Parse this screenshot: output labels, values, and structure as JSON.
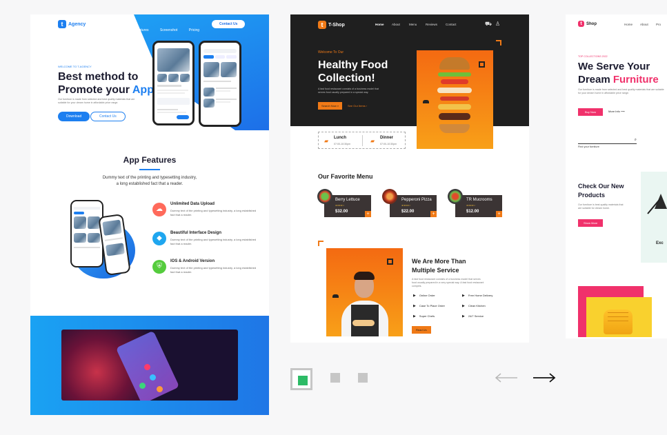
{
  "agency": {
    "brand": "Agency",
    "logo_letter": "t",
    "nav": [
      "Home",
      "Features",
      "Screenshot",
      "Pricing"
    ],
    "contact_button": "Contact Us",
    "eyebrow": "WELCOME TO T-AGENCY",
    "headline_line1": "Best method to",
    "headline_line2_a": "Promote your ",
    "headline_line2_b": "App",
    "description": "Our furniture is made from selected and best quality materials that are suitable for your dream home in affordable price range.",
    "download_button": "Download",
    "contact_button2": "Contact Us",
    "features_title": "App Features",
    "features_subtitle_1": "Dummy text of the printing and typesetting industry,",
    "features_subtitle_2": "a long established fact that a reader.",
    "features": [
      {
        "title": "Unlimited Data Upload",
        "desc": "Dummy text of the printing and typesetting industry, a long established fact that a reader.",
        "color": "#ff6a5b"
      },
      {
        "title": "Beautiful Interface Design",
        "desc": "Dummy text of the printing and typesetting industry, a long established fact that a reader.",
        "color": "#1fa6ef"
      },
      {
        "title": "IOS & Android Version",
        "desc": "Dummy text of the printing and typesetting industry, a long established fact that a reader.",
        "color": "#55cc3d"
      }
    ],
    "colors": {
      "accent": "#1d7ff0",
      "gradient_end": "#1d6fe8"
    }
  },
  "tshop": {
    "brand": "T-Shop",
    "logo_letter": "t",
    "nav": [
      "Home",
      "About",
      "Menu",
      "Reviews",
      "Contact"
    ],
    "eyebrow": "Welcome To Our",
    "headline_line1": "Healthy Food",
    "headline_line2": "Collection!",
    "description": "A fast food restaurant consists of a business model that serves food usually prepared in a special way.",
    "search_button": "Search Now",
    "our_items_link": "See Our Items",
    "hours": [
      {
        "label": "Lunch",
        "time": "07:00-10:30pm"
      },
      {
        "label": "Dinner",
        "time": "07:00-10:30pm"
      }
    ],
    "menu_title": "Our Favorite Menu",
    "menu": [
      {
        "name": "Berry Lettuce",
        "price": "$32.00"
      },
      {
        "name": "Pepperoni Pizza",
        "price": "$22.00"
      },
      {
        "name": "TR Mucrooms",
        "price": "$12.00"
      }
    ],
    "about_title_1": "We Are More Than",
    "about_title_2": "Multiple Service",
    "about_desc": "A fast food restaurant consists of a business model that serves food usually prepared in a very special way. A fast food restaurant compels.",
    "services": [
      "Online Order",
      "Free Home Delivery",
      "Case To Place Order",
      "Clean Kitchen",
      "Super Chefs",
      "24/7 Service"
    ],
    "read_button": "Read Us",
    "colors": {
      "accent": "#f07a17",
      "dark": "#1f1f1f"
    }
  },
  "furniture": {
    "brand": "Shop",
    "logo_letter": "t",
    "nav": [
      "Home",
      "About",
      "Pro"
    ],
    "eyebrow": "TOP COLLECTIONS 2022",
    "headline_line1": "We Serve Your",
    "headline_line2_a": "Dream ",
    "headline_line2_b": "Furniture",
    "description": "Our furniture is made from selected and best quality materials that are suitable for your dream home in affordable price range.",
    "buy_button": "Buy Now",
    "more_link": "More Info",
    "search_placeholder": "Find your furniture",
    "products_title_1": "Check Our New",
    "products_title_2": "Products",
    "products_desc": "Our furniture is best quality materials that are suitable for dream home.",
    "show_button": "Show More",
    "card_text": "Exc",
    "colors": {
      "accent": "#f0316b"
    }
  },
  "carousel": {
    "active_dot_color": "#2dbb66",
    "inactive_dot_color": "#c6c6c6",
    "prev_icon": "arrow-left-icon",
    "next_icon": "arrow-right-icon"
  }
}
